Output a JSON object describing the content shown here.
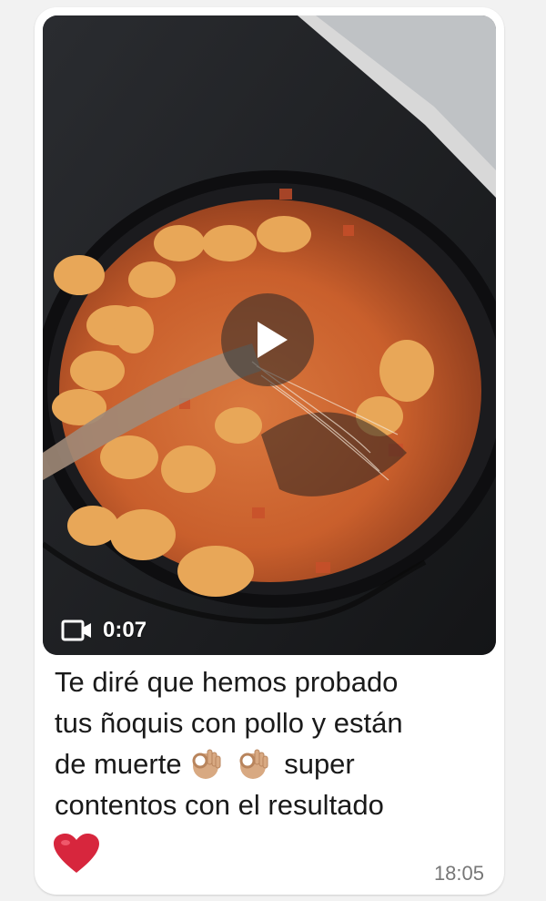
{
  "message": {
    "video": {
      "duration": "0:07",
      "play_icon": "play-icon",
      "camera_icon": "video-camera-icon"
    },
    "caption_lines": [
      "Te diré que hemos probado",
      "tus ñoquis con pollo y están",
      "de muerte",
      "super",
      "contentos con el resultado"
    ],
    "emojis": [
      "ok-hand-emoji",
      "ok-hand-emoji",
      "red-heart-emoji"
    ],
    "timestamp": "18:05"
  },
  "colors": {
    "bubble": "#ffffff",
    "background": "#f2f2f2",
    "text": "#1a1a1a",
    "timestamp": "#777777",
    "heart": "#d7263d"
  }
}
